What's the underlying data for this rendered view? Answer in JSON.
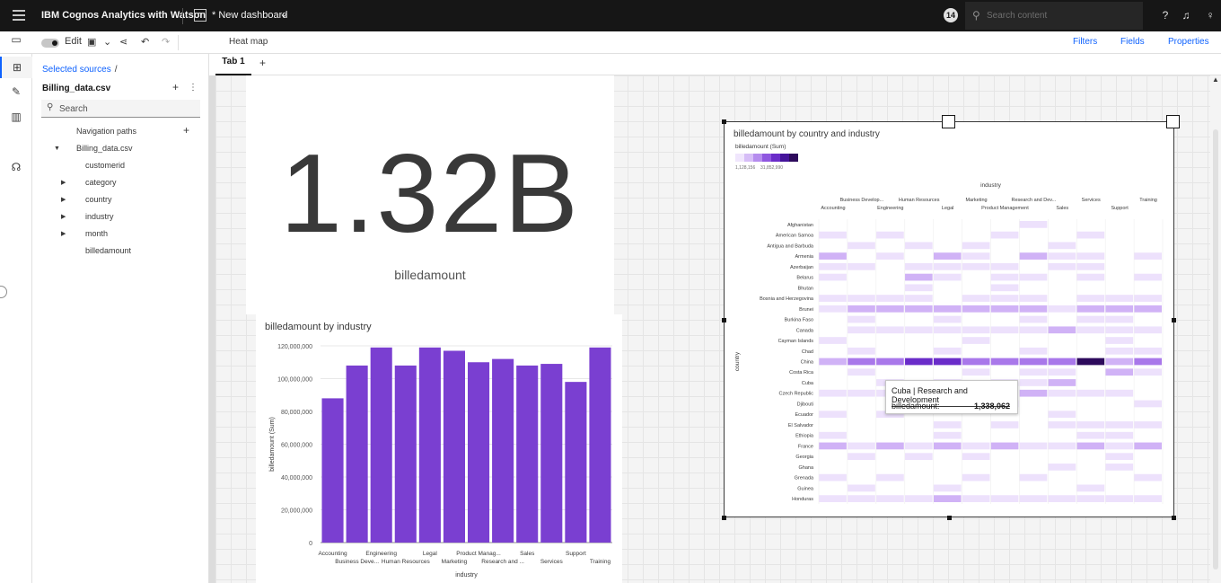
{
  "app": {
    "title": "IBM Cognos Analytics with Watson",
    "dashboard_name": "* New dashboard",
    "notifications_count": "14",
    "search_placeholder": "Search content"
  },
  "toolbar": {
    "edit_label": "Edit",
    "widget_title": "Heat map",
    "filters_label": "Filters",
    "fields_label": "Fields",
    "properties_label": "Properties"
  },
  "sources": {
    "breadcrumb": "Selected sources",
    "breadcrumb_sep": "/",
    "source_name": "Billing_data.csv",
    "search_placeholder": "Search",
    "nav_paths": "Navigation paths",
    "tree_root": "Billing_data.csv",
    "fields": [
      "customerid",
      "category",
      "country",
      "industry",
      "month",
      "billedamount"
    ]
  },
  "tabs": [
    {
      "label": "Tab 1"
    }
  ],
  "kpi": {
    "value": "1.32B",
    "label": "billedamount"
  },
  "bar_chart": {
    "title": "billedamount by industry",
    "ylabel": "billedamount (Sum)",
    "xlabel": "industry"
  },
  "heatmap": {
    "title": "billedamount by country and industry",
    "legend_title": "billedamount (Sum)",
    "legend_min": "1,128,156",
    "legend_max": "31,852,990",
    "xaxis_title": "industry",
    "yaxis_title": "country"
  },
  "tooltip": {
    "title": "Cuba | Research and Development",
    "measure_label": "billedamount:",
    "measure_value": "1,338,062"
  },
  "colors": {
    "accent": "#0f62fe",
    "bar": "#7a3fd1",
    "heat_low": "#f3ecfd",
    "heat_high": "#2d0a5c"
  },
  "chart_data": [
    {
      "type": "bar",
      "title": "billedamount by industry",
      "xlabel": "industry",
      "ylabel": "billedamount (Sum)",
      "ylim": [
        0,
        120000000
      ],
      "yticks": [
        "0",
        "20,000,000",
        "40,000,000",
        "60,000,000",
        "80,000,000",
        "100,000,000",
        "120,000,000"
      ],
      "categories": [
        "Accounting",
        "Business Deve...",
        "Engineering",
        "Human Resources",
        "Legal",
        "Marketing",
        "Product Manag...",
        "Research and ...",
        "Sales",
        "Services",
        "Support",
        "Training"
      ],
      "values": [
        88000000,
        108000000,
        119000000,
        108000000,
        119000000,
        117000000,
        110000000,
        112000000,
        108000000,
        109000000,
        98000000,
        119000000
      ]
    },
    {
      "type": "heatmap",
      "title": "billedamount by country and industry",
      "xlabel": "industry",
      "ylabel": "country",
      "x_top_row": [
        "Business Develop...",
        "Human Resources",
        "Marketing",
        "Research and Dev...",
        "Services",
        "Training"
      ],
      "x_bottom_row": [
        "Accounting",
        "Engineering",
        "Legal",
        "Product Management",
        "Sales",
        "Support"
      ],
      "x": [
        "Accounting",
        "Business Develop...",
        "Engineering",
        "Human Resources",
        "Legal",
        "Marketing",
        "Product Management",
        "Research and Dev...",
        "Sales",
        "Services",
        "Support",
        "Training"
      ],
      "y": [
        "Afghanistan",
        "American Samoa",
        "Antigua and Barbuda",
        "Armenia",
        "Azerbaijan",
        "Belarus",
        "Bhutan",
        "Bosnia and Herzegovina",
        "Brunei",
        "Burkina Faso",
        "Canada",
        "Cayman Islands",
        "Chad",
        "China",
        "Costa Rica",
        "Cuba",
        "Czech Republic",
        "Djibouti",
        "Ecuador",
        "El Salvador",
        "Ethiopia",
        "France",
        "Georgia",
        "Ghana",
        "Grenada",
        "Guinea",
        "Honduras"
      ],
      "levels": [
        [
          0,
          0,
          0,
          0,
          0,
          0,
          0,
          1,
          0,
          0,
          0,
          0
        ],
        [
          1,
          0,
          1,
          0,
          0,
          0,
          1,
          0,
          0,
          1,
          0,
          0
        ],
        [
          0,
          1,
          0,
          1,
          0,
          1,
          0,
          0,
          1,
          0,
          0,
          0
        ],
        [
          2,
          0,
          1,
          0,
          2,
          1,
          0,
          2,
          1,
          1,
          0,
          1
        ],
        [
          1,
          1,
          0,
          1,
          1,
          1,
          1,
          0,
          1,
          1,
          0,
          0
        ],
        [
          1,
          0,
          0,
          2,
          1,
          0,
          1,
          1,
          0,
          1,
          0,
          1
        ],
        [
          0,
          0,
          0,
          1,
          0,
          0,
          1,
          0,
          0,
          0,
          0,
          0
        ],
        [
          1,
          1,
          1,
          1,
          0,
          1,
          1,
          1,
          0,
          1,
          1,
          1
        ],
        [
          1,
          2,
          2,
          2,
          2,
          2,
          2,
          2,
          1,
          2,
          2,
          2
        ],
        [
          0,
          1,
          0,
          0,
          1,
          0,
          0,
          1,
          0,
          1,
          1,
          0
        ],
        [
          0,
          1,
          1,
          1,
          1,
          1,
          1,
          1,
          2,
          1,
          1,
          1
        ],
        [
          1,
          0,
          0,
          0,
          0,
          1,
          0,
          0,
          0,
          0,
          1,
          0
        ],
        [
          0,
          1,
          0,
          0,
          1,
          0,
          0,
          1,
          0,
          0,
          1,
          1
        ],
        [
          2,
          3,
          3,
          4,
          4,
          3,
          3,
          3,
          3,
          5,
          2,
          3
        ],
        [
          0,
          1,
          0,
          0,
          0,
          1,
          0,
          1,
          1,
          0,
          2,
          1
        ],
        [
          0,
          0,
          1,
          0,
          1,
          0,
          1,
          1,
          2,
          0,
          0,
          0
        ],
        [
          1,
          1,
          1,
          0,
          0,
          1,
          0,
          2,
          1,
          1,
          1,
          0
        ],
        [
          0,
          0,
          0,
          0,
          1,
          0,
          1,
          0,
          0,
          0,
          0,
          1
        ],
        [
          1,
          0,
          1,
          0,
          0,
          0,
          0,
          0,
          1,
          0,
          0,
          0
        ],
        [
          0,
          0,
          0,
          0,
          1,
          0,
          1,
          0,
          1,
          1,
          1,
          1
        ],
        [
          1,
          0,
          0,
          0,
          1,
          0,
          0,
          0,
          0,
          1,
          1,
          0
        ],
        [
          2,
          1,
          2,
          1,
          2,
          1,
          2,
          1,
          1,
          2,
          1,
          2
        ],
        [
          0,
          1,
          0,
          1,
          0,
          1,
          0,
          0,
          0,
          0,
          1,
          0
        ],
        [
          0,
          0,
          0,
          0,
          0,
          0,
          0,
          0,
          1,
          0,
          1,
          0
        ],
        [
          1,
          0,
          1,
          0,
          0,
          1,
          0,
          1,
          0,
          0,
          0,
          1
        ],
        [
          0,
          1,
          0,
          0,
          1,
          0,
          0,
          0,
          0,
          1,
          0,
          0
        ],
        [
          1,
          1,
          1,
          1,
          2,
          1,
          1,
          1,
          1,
          1,
          1,
          1
        ]
      ],
      "legend_min": "1,128,156",
      "legend_max": "31,852,990"
    }
  ]
}
